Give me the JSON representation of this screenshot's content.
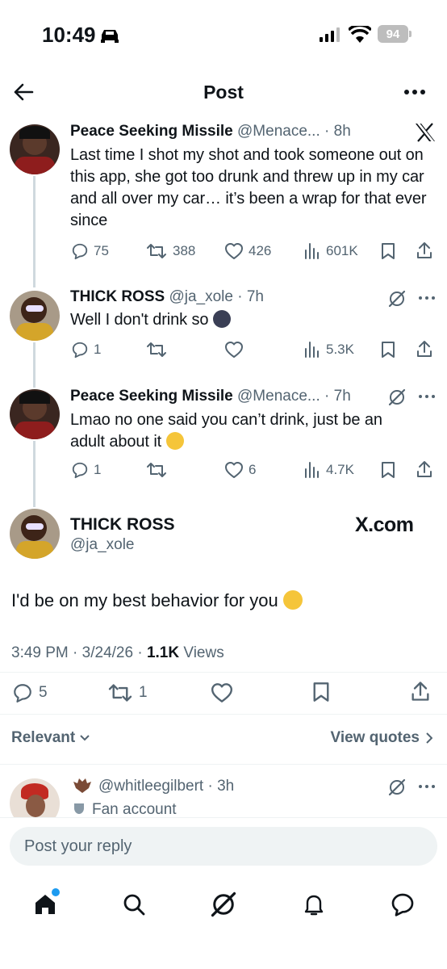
{
  "status_bar": {
    "time": "10:49",
    "battery": "94"
  },
  "header": {
    "title": "Post"
  },
  "tweets": [
    {
      "name": "Peace Seeking Missile",
      "handle": "@Menace...",
      "time": "8h",
      "text": "Last time I shot my shot and took someone out on this app, she got too drunk and threw up in my car and all over my car… it’s been a wrap for that ever since",
      "replies": "75",
      "reposts": "388",
      "likes": "426",
      "views": "601K"
    },
    {
      "name": "THICK ROSS",
      "handle": "@ja_xole",
      "time": "7h",
      "text": "Well I don't drink so",
      "replies": "1",
      "reposts": "",
      "likes": "",
      "views": "5.3K"
    },
    {
      "name": "Peace Seeking Missile",
      "handle": "@Menace...",
      "time": "7h",
      "text_line1": "Lmao no one said you can’t drink, just be an",
      "text_line2": "adult about it",
      "replies": "1",
      "reposts": "",
      "likes": "6",
      "views": "4.7K"
    }
  ],
  "main_post": {
    "name": "THICK ROSS",
    "handle": "@ja_xole",
    "watermark": "X.com",
    "text": "I'd be on my best behavior for you",
    "time": "3:49 PM",
    "date": "3/24/26",
    "views_count": "1.1K",
    "views_label": "Views",
    "replies": "5",
    "reposts": "1"
  },
  "filters": {
    "sort": "Relevant",
    "quotes": "View quotes"
  },
  "reply_preview": {
    "handle": "@whitleegilbert",
    "time": "3h",
    "badge": "Fan account"
  },
  "composer": {
    "placeholder": "Post your reply"
  },
  "colors": {
    "accent": "#1d9bf0",
    "muted": "#536471",
    "line": "#cfd9de"
  }
}
